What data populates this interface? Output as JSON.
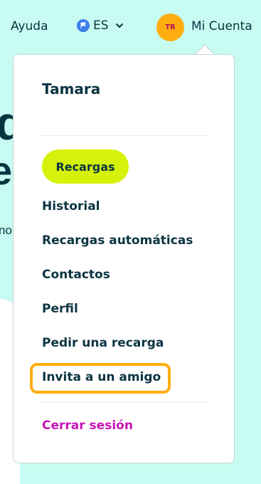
{
  "header": {
    "help_label": "Ayuda",
    "language": {
      "code": "ES",
      "icon": "flag-icon",
      "chevron": "chevron-down-icon"
    },
    "avatar_initials": "TR",
    "account_label": "Mi Cuenta"
  },
  "background": {
    "headline_fragment_1": "d",
    "headline_fragment_2": "es",
    "sub_fragment": "no"
  },
  "menu": {
    "user_name": "Tamara",
    "active_item": "Recargas",
    "items": [
      "Historial",
      "Recargas automáticas",
      "Contactos",
      "Perfil",
      "Pedir una recarga",
      "Invita a un amigo"
    ],
    "logout_label": "Cerrar sesión"
  },
  "colors": {
    "background": "#c8fbf1",
    "accent_lime": "#d6f20a",
    "highlight_orange": "#ffad0f",
    "logout_magenta": "#c815b4",
    "text_dark": "#0b3442"
  }
}
